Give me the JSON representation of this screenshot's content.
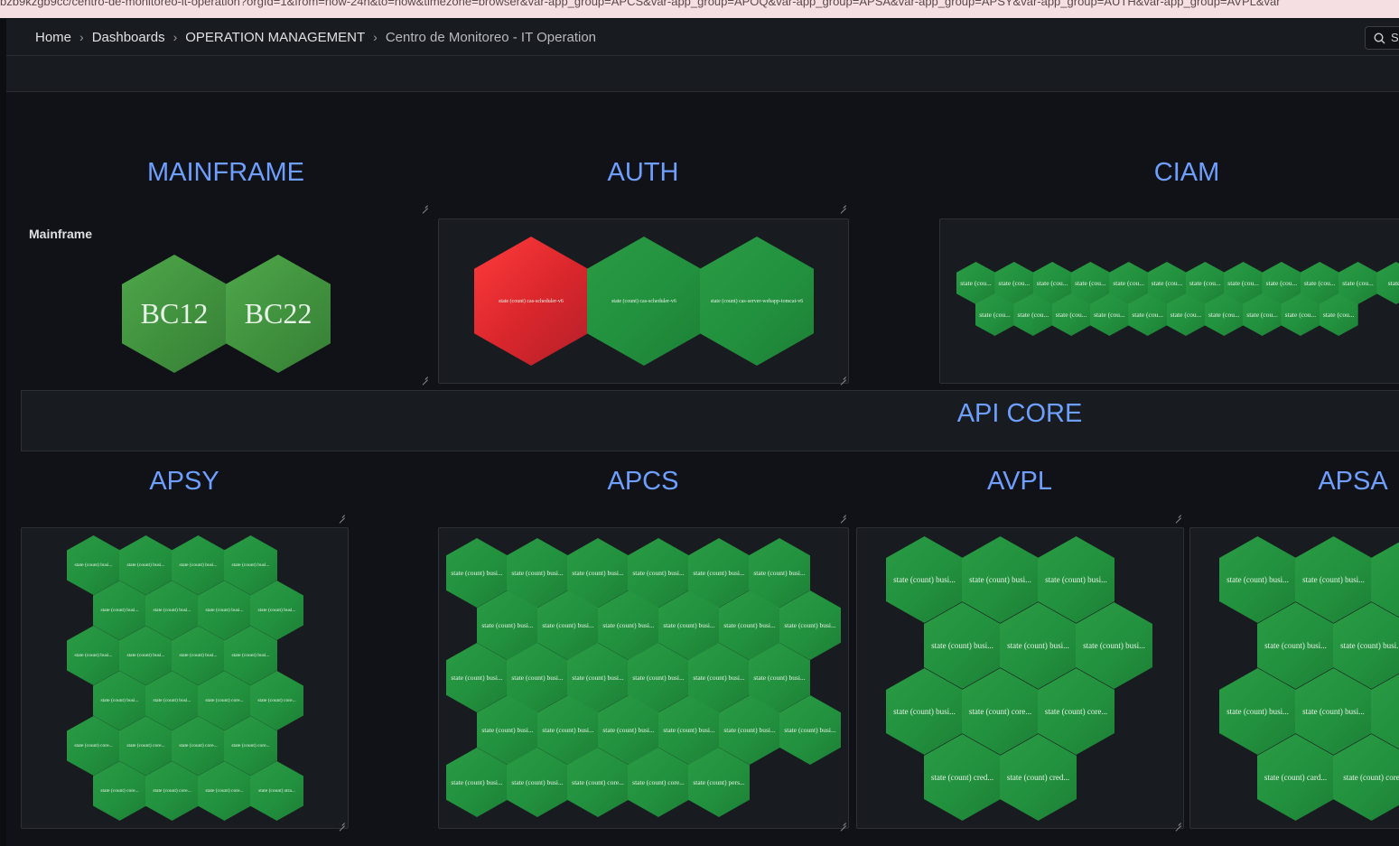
{
  "url": "bzb9kzgb9cc/centro-de-monitoreo-it-operation?orgId=1&from=now-24h&to=now&timezone=browser&var-app_group=APCS&var-app_group=APOQ&var-app_group=APSA&var-app_group=APSY&var-app_group=AUTH&var-app_group=AVPL&var",
  "breadcrumb": {
    "home": "Home",
    "dashboards": "Dashboards",
    "folder": "OPERATION MANAGEMENT",
    "current": "Centro de Monitoreo - IT Operation"
  },
  "search": {
    "label": "S"
  },
  "colors": {
    "ok": "#23913f",
    "alert": "#e32d35",
    "title": "#6e9fff"
  },
  "rows": {
    "mainframe": {
      "title": "MAINFRAME",
      "panel_title": "Mainframe",
      "hexes": [
        "BC12",
        "BC22"
      ]
    },
    "auth": {
      "title": "AUTH",
      "hexes": [
        {
          "label": "state (count) cas-scheduler-v6",
          "status": "alert"
        },
        {
          "label": "state (count) cas-scheduler-v6",
          "status": "ok"
        },
        {
          "label": "state (count) cas-server-webapp-tomcat-v6",
          "status": "ok"
        }
      ]
    },
    "ciam": {
      "title": "CIAM",
      "row1": [
        "state (cou...",
        "state (cou...",
        "state (cou...",
        "state (cou...",
        "state (cou...",
        "state (cou...",
        "state (cou...",
        "state (cou...",
        "state (cou...",
        "state (cou...",
        "state (cou...",
        "state ("
      ],
      "row2": [
        "state (cou...",
        "state (cou...",
        "state (cou...",
        "state (cou...",
        "state (cou...",
        "state (cou...",
        "state (cou...",
        "state (cou...",
        "state (cou...",
        "state (cou..."
      ]
    },
    "api_core": {
      "title": "API CORE"
    },
    "apsy": {
      "title": "APSY",
      "rows": [
        [
          "state (count) busi...",
          "state (count) busi...",
          "state (count) busi...",
          "state (count) busi..."
        ],
        [
          "state (count) busi...",
          "state (count) busi...",
          "state (count) busi...",
          "state (count) busi..."
        ],
        [
          "state (count) busi...",
          "state (count) busi...",
          "state (count) busi...",
          "state (count) busi..."
        ],
        [
          "state (count) busi...",
          "state (count) busi...",
          "state (count) core...",
          "state (count) core..."
        ],
        [
          "state (count) core...",
          "state (count) core...",
          "state (count) core...",
          "state (count) core..."
        ],
        [
          "state (count) core...",
          "state (count) core...",
          "state (count) core...",
          "state (count) stra..."
        ]
      ]
    },
    "apcs": {
      "title": "APCS",
      "rows": [
        [
          "state (count) busi...",
          "state (count) busi...",
          "state (count) busi...",
          "state (count) busi...",
          "state (count) busi...",
          "state (count) busi..."
        ],
        [
          "state (count) busi...",
          "state (count) busi...",
          "state (count) busi...",
          "state (count) busi...",
          "state (count) busi...",
          "state (count) busi..."
        ],
        [
          "state (count) busi...",
          "state (count) busi...",
          "state (count) busi...",
          "state (count) busi...",
          "state (count) busi...",
          "state (count) busi..."
        ],
        [
          "state (count) busi...",
          "state (count) busi...",
          "state (count) busi...",
          "state (count) busi...",
          "state (count) busi...",
          "state (count) busi..."
        ],
        [
          "state (count) busi...",
          "state (count) busi...",
          "state (count) core...",
          "state (count) core...",
          "state (count) pers..."
        ]
      ]
    },
    "avpl": {
      "title": "AVPL",
      "rows": [
        [
          "state (count) busi...",
          "state (count) busi...",
          "state (count) busi..."
        ],
        [
          "state (count) busi...",
          "state (count) busi...",
          "state (count) busi..."
        ],
        [
          "state (count) busi...",
          "state (count) core...",
          "state (count) core..."
        ],
        [
          "state (count) cred...",
          "state (count) cred..."
        ]
      ]
    },
    "apsa": {
      "title": "APSA",
      "rows": [
        [
          "state (count) busi...",
          "state (count) busi...",
          "state ("
        ],
        [
          "state (count) busi...",
          "state (count) busi..."
        ],
        [
          "state (count) busi...",
          "state (count) busi...",
          "state ("
        ],
        [
          "state (count) card...",
          "state (count) core"
        ]
      ]
    }
  }
}
